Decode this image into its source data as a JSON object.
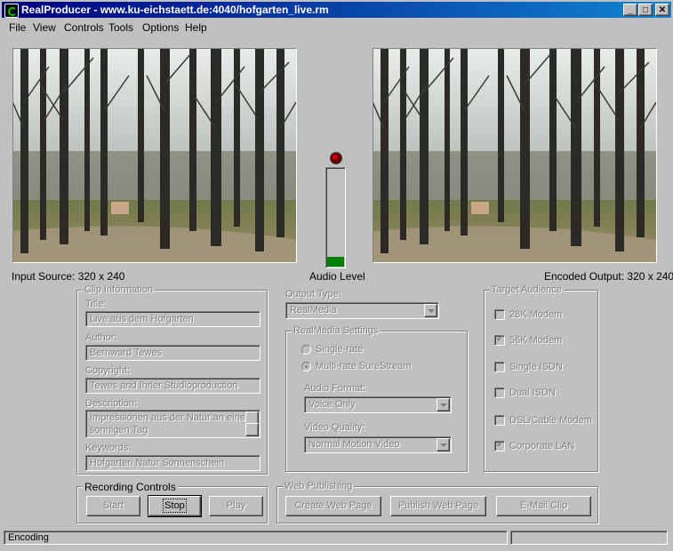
{
  "window": {
    "title": "RealProducer - www.ku-eichstaett.de:4040/hofgarten_live.rm",
    "minimize": "_",
    "maximize": "□",
    "close": "✕"
  },
  "menu": [
    "File",
    "View",
    "Controls",
    "Tools",
    "Options",
    "Help"
  ],
  "panes": {
    "input_label": "Input Source: 320 x 240",
    "output_label": "Encoded Output: 320 x 240",
    "audio_label": "Audio Level",
    "audio_level": 0.1
  },
  "clip_info": {
    "legend": "Clip Information",
    "title_label": "Title:",
    "title_value": "Live aus dem Hofgarten",
    "author_label": "Author:",
    "author_value": "Bernward Tewes",
    "copyright_label": "Copyright:",
    "copyright_value": "Tewes and Ihrler Studioproduction",
    "description_label": "Description:",
    "description_line1": "Impressionen aus der Natur an einem",
    "description_line2": "sonnigen Tag",
    "keywords_label": "Keywords:",
    "keywords_value": "Hofgarten Natur Sonnenschein"
  },
  "output": {
    "type_label": "Output Type:",
    "type_value": "RealMedia",
    "settings_legend": "RealMedia Settings",
    "single_rate": "Single-rate",
    "multi_rate": "Multi-rate SureStream",
    "audio_format_label": "Audio Format:",
    "audio_format_value": "Voice Only",
    "video_quality_label": "Video Quality:",
    "video_quality_value": "Normal Motion Video"
  },
  "audience": {
    "legend": "Target Audience",
    "items": [
      {
        "label": "28K Modem",
        "checked": false
      },
      {
        "label": "56K Modem",
        "checked": true
      },
      {
        "label": "Single ISDN",
        "checked": false
      },
      {
        "label": "Dual ISDN",
        "checked": false
      },
      {
        "label": "DSL/Cable Modem",
        "checked": false
      },
      {
        "label": "Corporate LAN",
        "checked": true
      }
    ]
  },
  "recording": {
    "legend": "Recording Controls",
    "start": "Start",
    "stop": "Stop",
    "play": "Play"
  },
  "web": {
    "legend": "Web Publishing",
    "create": "Create Web Page",
    "publish": "Publish Web Page",
    "email": "E-Mail Clip"
  },
  "status": {
    "text": "Encoding"
  }
}
